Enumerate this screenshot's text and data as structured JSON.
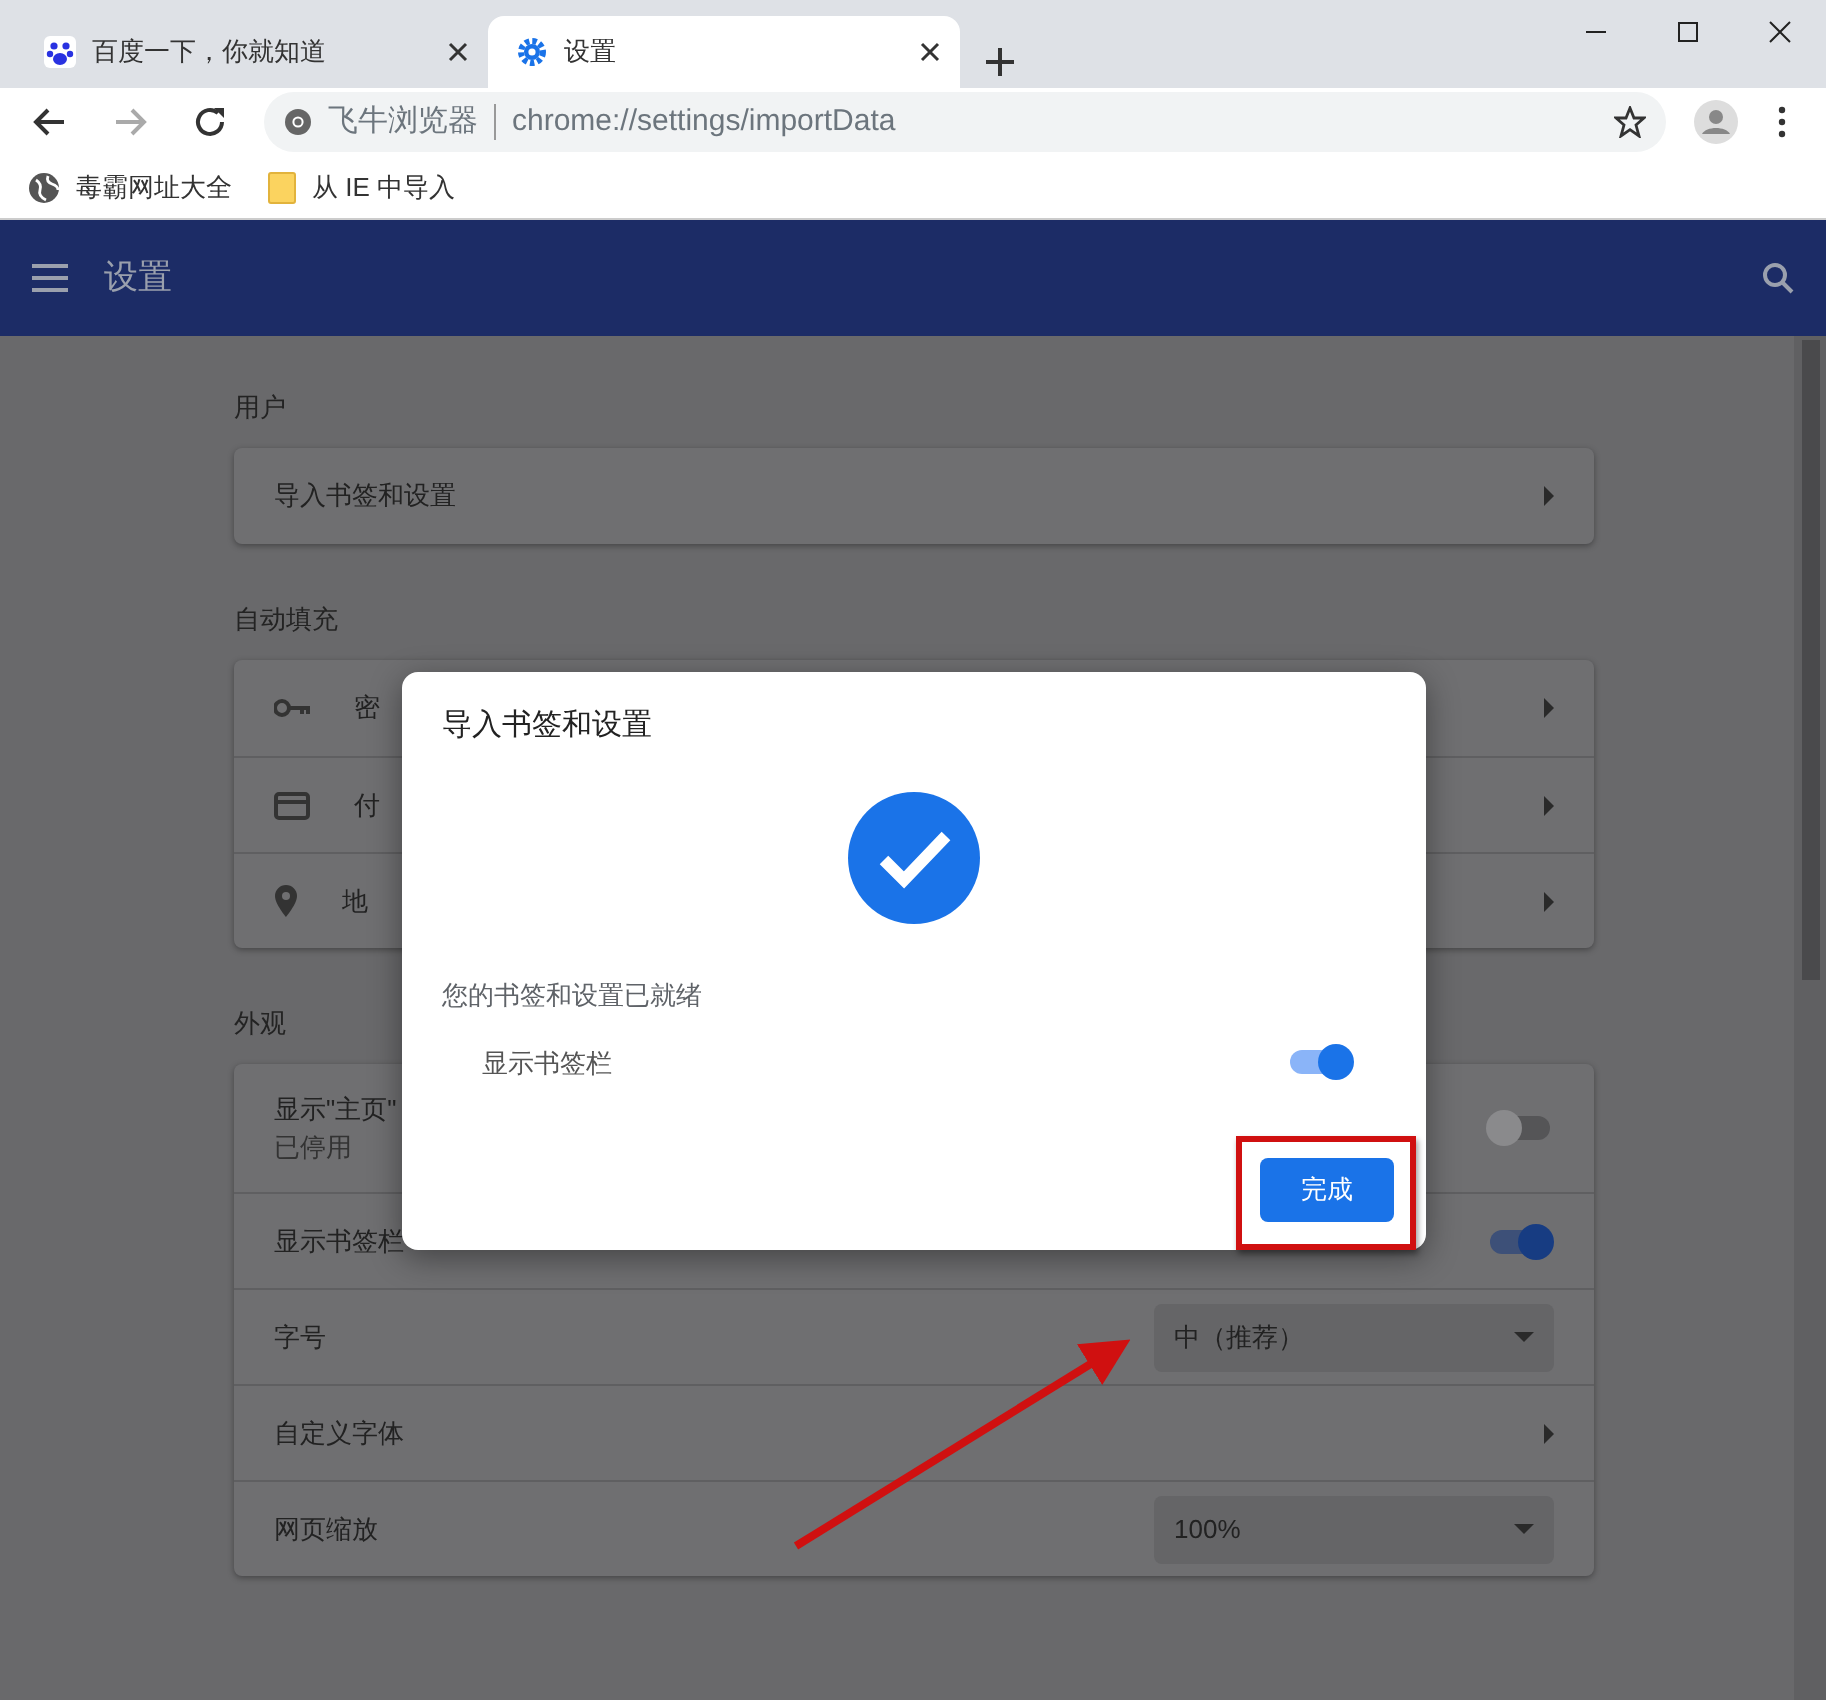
{
  "tabs": [
    {
      "title": "百度一下，你就知道",
      "kind": "paw",
      "selected": false
    },
    {
      "title": "设置",
      "kind": "gear",
      "selected": true
    }
  ],
  "address_bar": {
    "site_label": "飞牛浏览器",
    "url": "chrome://settings/importData"
  },
  "bookmarks": [
    {
      "label": "毒霸网址大全",
      "kind": "site"
    },
    {
      "label": "从 IE 中导入",
      "kind": "folder"
    }
  ],
  "header": {
    "title": "设置"
  },
  "sections": [
    {
      "title": "用户",
      "rows": [
        {
          "kind": "link",
          "label": "导入书签和设置"
        }
      ]
    },
    {
      "title": "自动填充",
      "rows": [
        {
          "kind": "link",
          "label": "密"
        },
        {
          "kind": "link",
          "label": "付"
        },
        {
          "kind": "link",
          "label": "地"
        }
      ]
    },
    {
      "title": "外观",
      "rows": [
        {
          "kind": "toggle",
          "label": "显示\"主页\"",
          "sublabel": "已停用",
          "on": false
        },
        {
          "kind": "toggle",
          "label": "显示书签栏",
          "on": true
        },
        {
          "kind": "select",
          "label": "字号",
          "value": "中（推荐）"
        },
        {
          "kind": "link",
          "label": "自定义字体"
        },
        {
          "kind": "select",
          "label": "网页缩放",
          "value": "100%"
        }
      ]
    }
  ],
  "dialog": {
    "title": "导入书签和设置",
    "message": "您的书签和设置已就绪",
    "toggle": {
      "label": "显示书签栏",
      "on": true
    },
    "button": "完成"
  }
}
